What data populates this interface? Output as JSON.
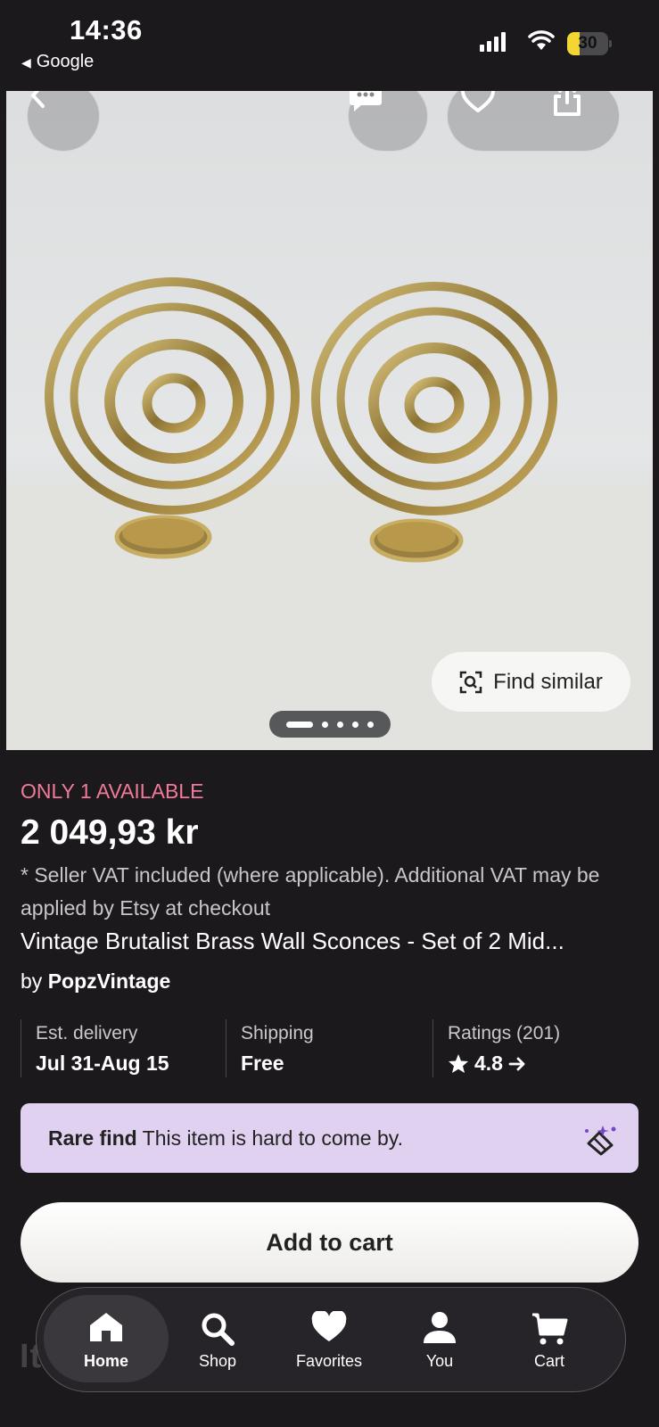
{
  "status_bar": {
    "time": "14:36",
    "back_app": "Google",
    "battery": "30",
    "battery_level": 0.3
  },
  "photo": {
    "find_similar": "Find similar",
    "carousel_count": 5,
    "carousel_active": 0
  },
  "listing": {
    "stock_note": "ONLY 1 AVAILABLE",
    "price": "2 049,93 kr",
    "vat_note": "* Seller VAT included (where applicable). Additional VAT may be applied by Etsy at checkout",
    "title": "Vintage Brutalist Brass Wall Sconces - Set of 2 Mid...",
    "seller_prefix": "by",
    "seller_name": "PopzVintage"
  },
  "stats": {
    "delivery_label": "Est. delivery",
    "delivery_value": "Jul 31-Aug 15",
    "shipping_label": "Shipping",
    "shipping_value": "Free",
    "ratings_label": "Ratings (201)",
    "ratings_value": "4.8"
  },
  "rare_find": {
    "title": "Rare find",
    "text": "This item is hard to come by."
  },
  "add_to_cart": "Add to cart",
  "below_fold_text": "It",
  "tabs": [
    {
      "label": "Home",
      "icon": "home-icon",
      "active": true
    },
    {
      "label": "Shop",
      "icon": "search-icon",
      "active": false
    },
    {
      "label": "Favorites",
      "icon": "heart-icon",
      "active": false
    },
    {
      "label": "You",
      "icon": "person-icon",
      "active": false
    },
    {
      "label": "Cart",
      "icon": "cart-icon",
      "active": false
    }
  ],
  "colors": {
    "background": "#1c191d",
    "stock_accent": "#f17a99",
    "rare_find_bg": "#dfd1ef",
    "battery": "#f3d534"
  }
}
